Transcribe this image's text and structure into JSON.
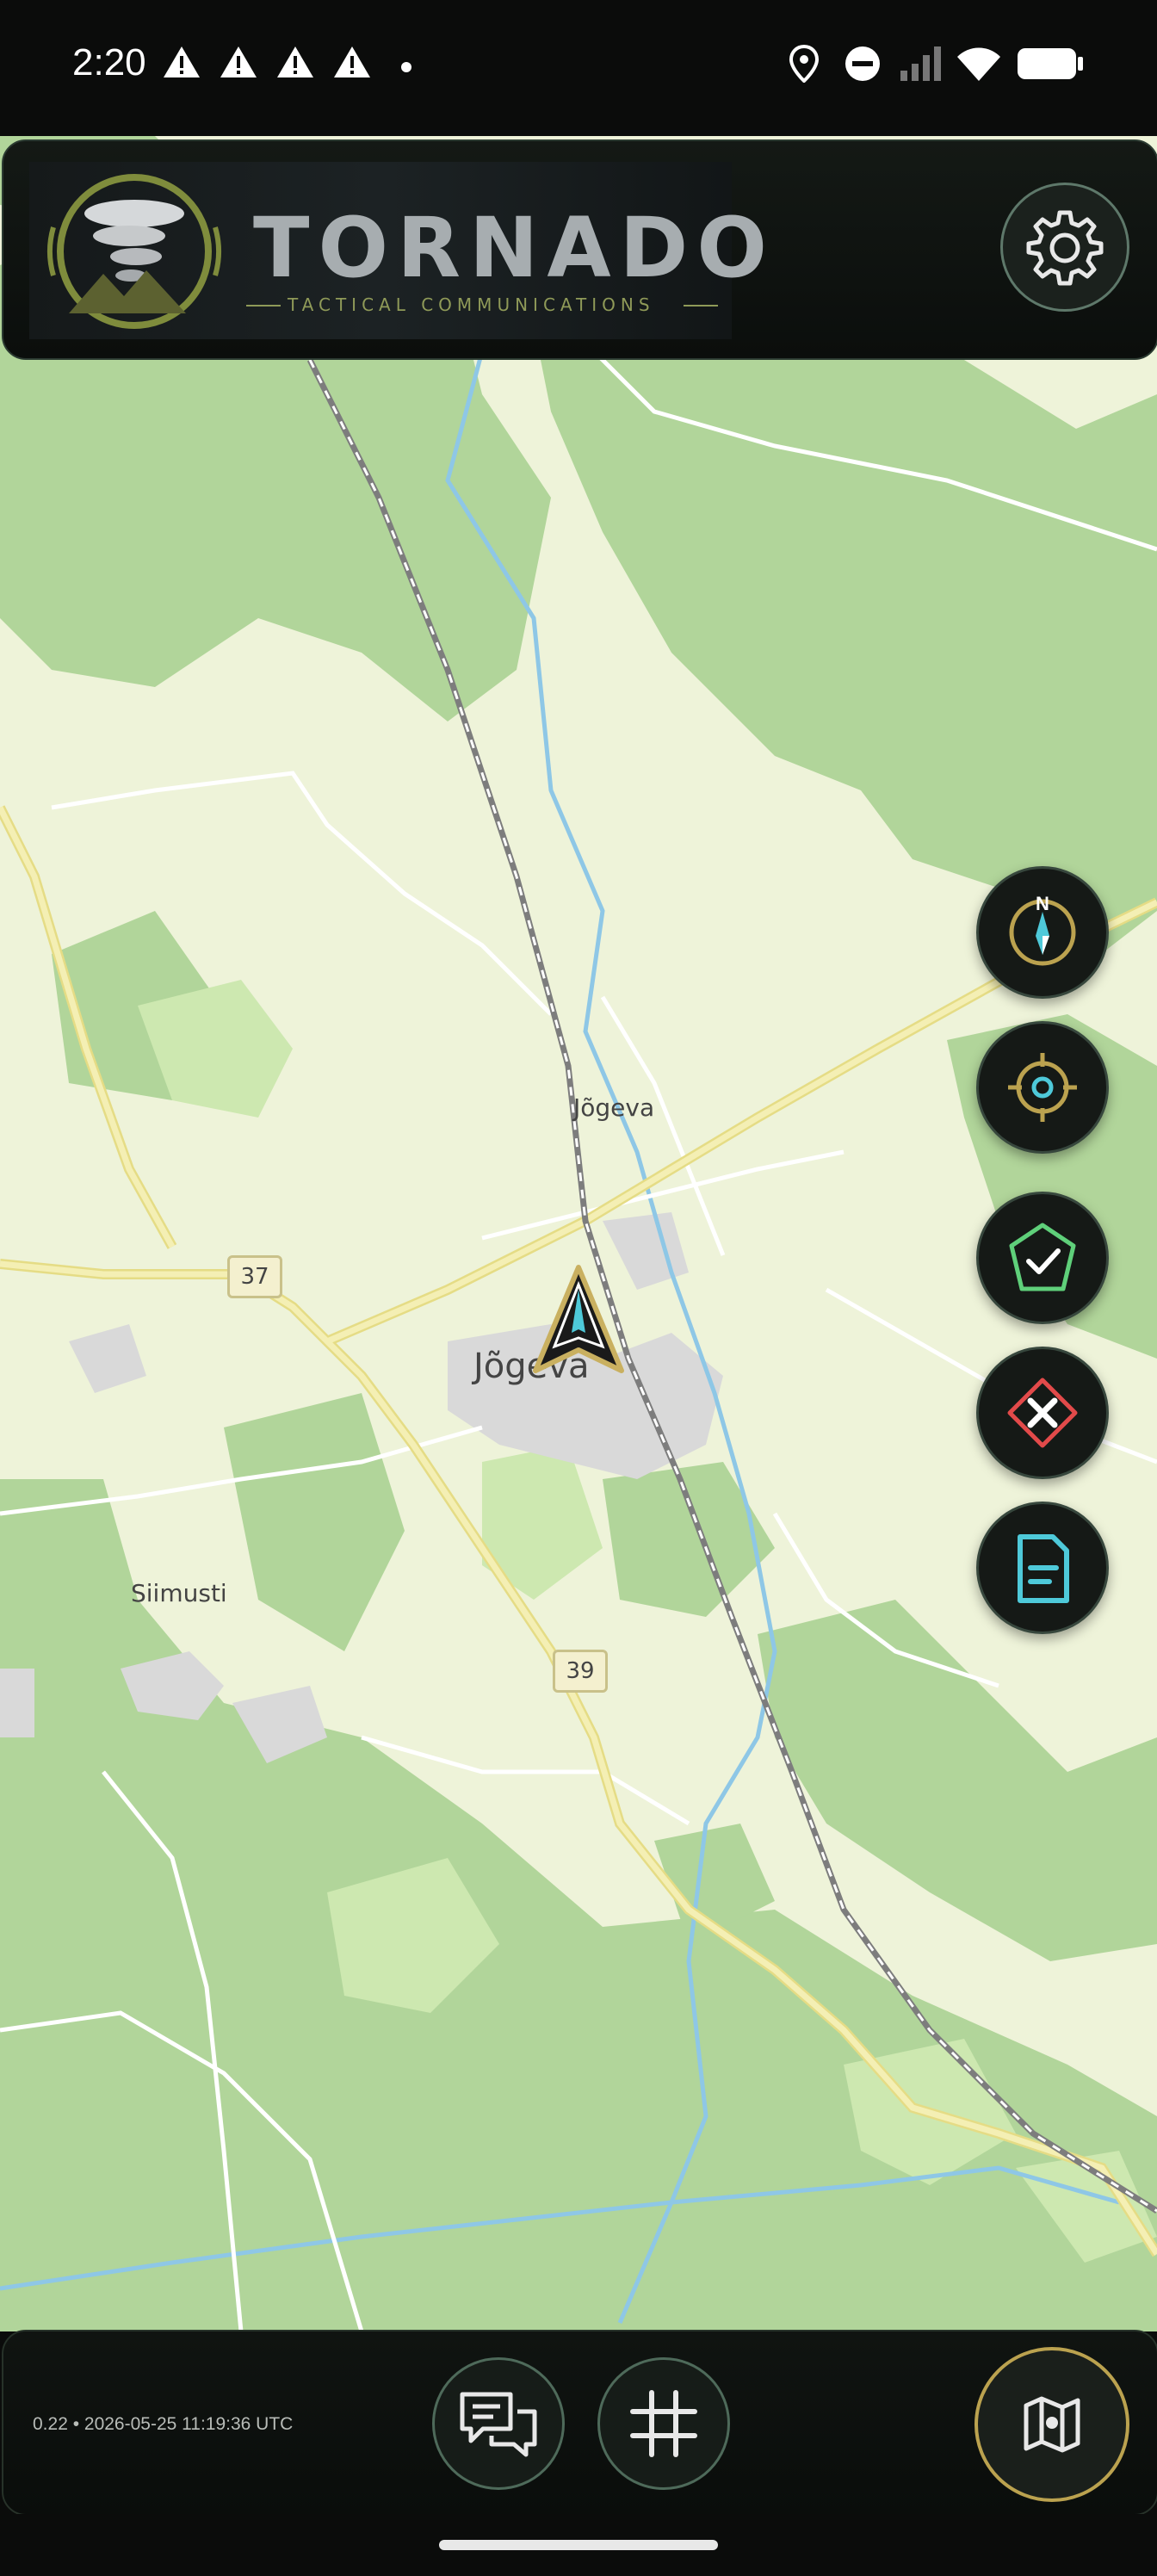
{
  "status_bar": {
    "time": "2:20",
    "warning_icons": [
      "warning-icon",
      "warning-icon",
      "warning-icon",
      "warning-icon"
    ],
    "right_icons": [
      "location-icon",
      "do-not-disturb-icon",
      "signal-icon",
      "wifi-icon",
      "battery-icon"
    ]
  },
  "header": {
    "logo_word": "TORNADO",
    "logo_subtitle": "TACTICAL COMMUNICATIONS",
    "settings_icon": "gear-icon"
  },
  "map": {
    "place_labels": [
      {
        "id": "jogeva-village",
        "text": "Jõgeva"
      },
      {
        "id": "jogeva-town",
        "text": "Jõgeva"
      },
      {
        "id": "siimusti",
        "text": "Siimusti"
      }
    ],
    "road_shields": [
      "37",
      "39"
    ],
    "colors": {
      "forest": "#b1d59a",
      "meadow": "#cde8b0",
      "base": "#eef3d9",
      "road_major": "#f2eb9e",
      "rail": "#8c8c8c",
      "water": "#8ec7e6"
    }
  },
  "map_controls": {
    "compass_label": "N",
    "buttons": [
      "compass-icon",
      "locate-icon",
      "shield-check-icon",
      "close-diamond-icon",
      "document-icon"
    ]
  },
  "bottom_bar": {
    "build_info": "0.22 • 2026-05-25 11:19:36 UTC",
    "chat_icon": "chat-icon",
    "grid_icon": "grid-icon",
    "map_icon": "map-icon"
  },
  "accent_colors": {
    "gold": "#bba24f",
    "teal": "#4ec9d9",
    "green": "#5fd07a",
    "red": "#e24a4a"
  }
}
